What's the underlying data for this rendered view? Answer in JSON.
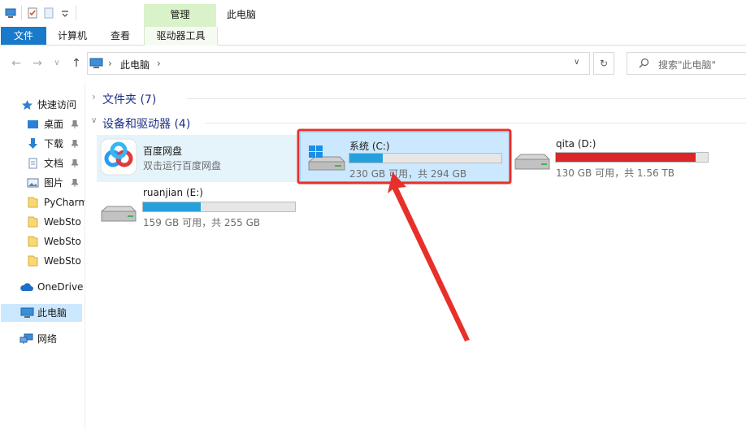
{
  "window": {
    "title": "此电脑",
    "context_tab": "管理"
  },
  "ribbon": {
    "tabs": [
      {
        "label": "文件"
      },
      {
        "label": "计算机"
      },
      {
        "label": "查看"
      },
      {
        "label": "驱动器工具"
      }
    ]
  },
  "address": {
    "path": "此电脑",
    "separator": "›"
  },
  "search": {
    "placeholder": "搜索\"此电脑\""
  },
  "sidebar": {
    "quick_access": "快速访问",
    "items": [
      {
        "label": "桌面"
      },
      {
        "label": "下载"
      },
      {
        "label": "文档"
      },
      {
        "label": "图片"
      },
      {
        "label": "PyCharm"
      },
      {
        "label": "WebSto"
      },
      {
        "label": "WebSto"
      },
      {
        "label": "WebSto"
      }
    ],
    "onedrive": "OneDrive",
    "this_pc": "此电脑",
    "network": "网络"
  },
  "content": {
    "folders_header": "文件夹 (7)",
    "devices_header": "设备和驱动器 (4)",
    "baidu": {
      "name": "百度网盘",
      "sub": "双击运行百度网盘"
    },
    "drives": [
      {
        "name": "系统 (C:)",
        "free_text": "230 GB 可用，共 294 GB",
        "used_fraction": 0.22,
        "color": "#26a0da"
      },
      {
        "name": "qita (D:)",
        "free_text": "130 GB 可用，共 1.56 TB",
        "used_fraction": 0.92,
        "color": "#da2626"
      },
      {
        "name": "ruanjian (E:)",
        "free_text": "159 GB 可用，共 255 GB",
        "used_fraction": 0.38,
        "color": "#26a0da"
      }
    ]
  },
  "annotation": {
    "color": "#e8302a"
  },
  "colors": {
    "accent": "#1979ca",
    "selection": "#cce8ff",
    "manage_tab": "#d9f2c9",
    "header_text": "#1e3287"
  }
}
